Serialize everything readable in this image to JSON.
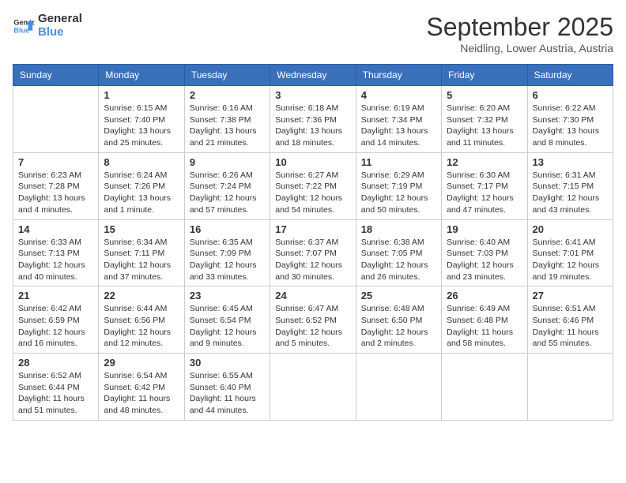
{
  "logo": {
    "text_general": "General",
    "text_blue": "Blue"
  },
  "header": {
    "month": "September 2025",
    "location": "Neidling, Lower Austria, Austria"
  },
  "weekdays": [
    "Sunday",
    "Monday",
    "Tuesday",
    "Wednesday",
    "Thursday",
    "Friday",
    "Saturday"
  ],
  "weeks": [
    [
      {
        "day": "",
        "info": ""
      },
      {
        "day": "1",
        "info": "Sunrise: 6:15 AM\nSunset: 7:40 PM\nDaylight: 13 hours\nand 25 minutes."
      },
      {
        "day": "2",
        "info": "Sunrise: 6:16 AM\nSunset: 7:38 PM\nDaylight: 13 hours\nand 21 minutes."
      },
      {
        "day": "3",
        "info": "Sunrise: 6:18 AM\nSunset: 7:36 PM\nDaylight: 13 hours\nand 18 minutes."
      },
      {
        "day": "4",
        "info": "Sunrise: 6:19 AM\nSunset: 7:34 PM\nDaylight: 13 hours\nand 14 minutes."
      },
      {
        "day": "5",
        "info": "Sunrise: 6:20 AM\nSunset: 7:32 PM\nDaylight: 13 hours\nand 11 minutes."
      },
      {
        "day": "6",
        "info": "Sunrise: 6:22 AM\nSunset: 7:30 PM\nDaylight: 13 hours\nand 8 minutes."
      }
    ],
    [
      {
        "day": "7",
        "info": "Sunrise: 6:23 AM\nSunset: 7:28 PM\nDaylight: 13 hours\nand 4 minutes."
      },
      {
        "day": "8",
        "info": "Sunrise: 6:24 AM\nSunset: 7:26 PM\nDaylight: 13 hours\nand 1 minute."
      },
      {
        "day": "9",
        "info": "Sunrise: 6:26 AM\nSunset: 7:24 PM\nDaylight: 12 hours\nand 57 minutes."
      },
      {
        "day": "10",
        "info": "Sunrise: 6:27 AM\nSunset: 7:22 PM\nDaylight: 12 hours\nand 54 minutes."
      },
      {
        "day": "11",
        "info": "Sunrise: 6:29 AM\nSunset: 7:19 PM\nDaylight: 12 hours\nand 50 minutes."
      },
      {
        "day": "12",
        "info": "Sunrise: 6:30 AM\nSunset: 7:17 PM\nDaylight: 12 hours\nand 47 minutes."
      },
      {
        "day": "13",
        "info": "Sunrise: 6:31 AM\nSunset: 7:15 PM\nDaylight: 12 hours\nand 43 minutes."
      }
    ],
    [
      {
        "day": "14",
        "info": "Sunrise: 6:33 AM\nSunset: 7:13 PM\nDaylight: 12 hours\nand 40 minutes."
      },
      {
        "day": "15",
        "info": "Sunrise: 6:34 AM\nSunset: 7:11 PM\nDaylight: 12 hours\nand 37 minutes."
      },
      {
        "day": "16",
        "info": "Sunrise: 6:35 AM\nSunset: 7:09 PM\nDaylight: 12 hours\nand 33 minutes."
      },
      {
        "day": "17",
        "info": "Sunrise: 6:37 AM\nSunset: 7:07 PM\nDaylight: 12 hours\nand 30 minutes."
      },
      {
        "day": "18",
        "info": "Sunrise: 6:38 AM\nSunset: 7:05 PM\nDaylight: 12 hours\nand 26 minutes."
      },
      {
        "day": "19",
        "info": "Sunrise: 6:40 AM\nSunset: 7:03 PM\nDaylight: 12 hours\nand 23 minutes."
      },
      {
        "day": "20",
        "info": "Sunrise: 6:41 AM\nSunset: 7:01 PM\nDaylight: 12 hours\nand 19 minutes."
      }
    ],
    [
      {
        "day": "21",
        "info": "Sunrise: 6:42 AM\nSunset: 6:59 PM\nDaylight: 12 hours\nand 16 minutes."
      },
      {
        "day": "22",
        "info": "Sunrise: 6:44 AM\nSunset: 6:56 PM\nDaylight: 12 hours\nand 12 minutes."
      },
      {
        "day": "23",
        "info": "Sunrise: 6:45 AM\nSunset: 6:54 PM\nDaylight: 12 hours\nand 9 minutes."
      },
      {
        "day": "24",
        "info": "Sunrise: 6:47 AM\nSunset: 6:52 PM\nDaylight: 12 hours\nand 5 minutes."
      },
      {
        "day": "25",
        "info": "Sunrise: 6:48 AM\nSunset: 6:50 PM\nDaylight: 12 hours\nand 2 minutes."
      },
      {
        "day": "26",
        "info": "Sunrise: 6:49 AM\nSunset: 6:48 PM\nDaylight: 11 hours\nand 58 minutes."
      },
      {
        "day": "27",
        "info": "Sunrise: 6:51 AM\nSunset: 6:46 PM\nDaylight: 11 hours\nand 55 minutes."
      }
    ],
    [
      {
        "day": "28",
        "info": "Sunrise: 6:52 AM\nSunset: 6:44 PM\nDaylight: 11 hours\nand 51 minutes."
      },
      {
        "day": "29",
        "info": "Sunrise: 6:54 AM\nSunset: 6:42 PM\nDaylight: 11 hours\nand 48 minutes."
      },
      {
        "day": "30",
        "info": "Sunrise: 6:55 AM\nSunset: 6:40 PM\nDaylight: 11 hours\nand 44 minutes."
      },
      {
        "day": "",
        "info": ""
      },
      {
        "day": "",
        "info": ""
      },
      {
        "day": "",
        "info": ""
      },
      {
        "day": "",
        "info": ""
      }
    ]
  ]
}
